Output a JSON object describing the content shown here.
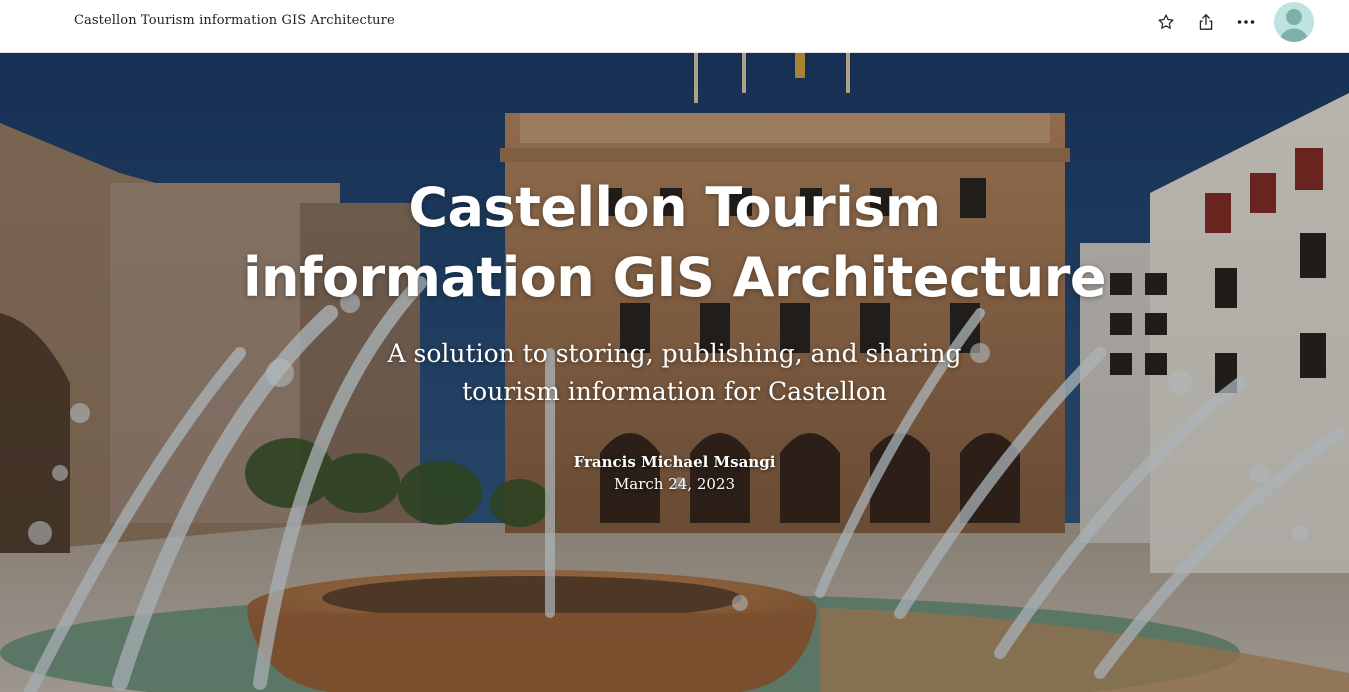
{
  "header": {
    "title": "Castellon Tourism information GIS Architecture",
    "actions": [
      {
        "icon": "star-icon"
      },
      {
        "icon": "share-icon"
      },
      {
        "icon": "more-icon"
      }
    ],
    "avatar_icon": "user-avatar-icon"
  },
  "hero": {
    "title": "Castellon Tourism information GIS Architecture",
    "subtitle": "A solution to storing, publishing, and sharing tourism information for Castellon",
    "author": "Francis Michael Msangi",
    "date": "March 24, 2023"
  },
  "colors": {
    "header_bg": "#ffffff",
    "avatar_bg": "#bfe4df",
    "avatar_figure": "#7fb0a7",
    "hero_text": "#ffffff"
  }
}
